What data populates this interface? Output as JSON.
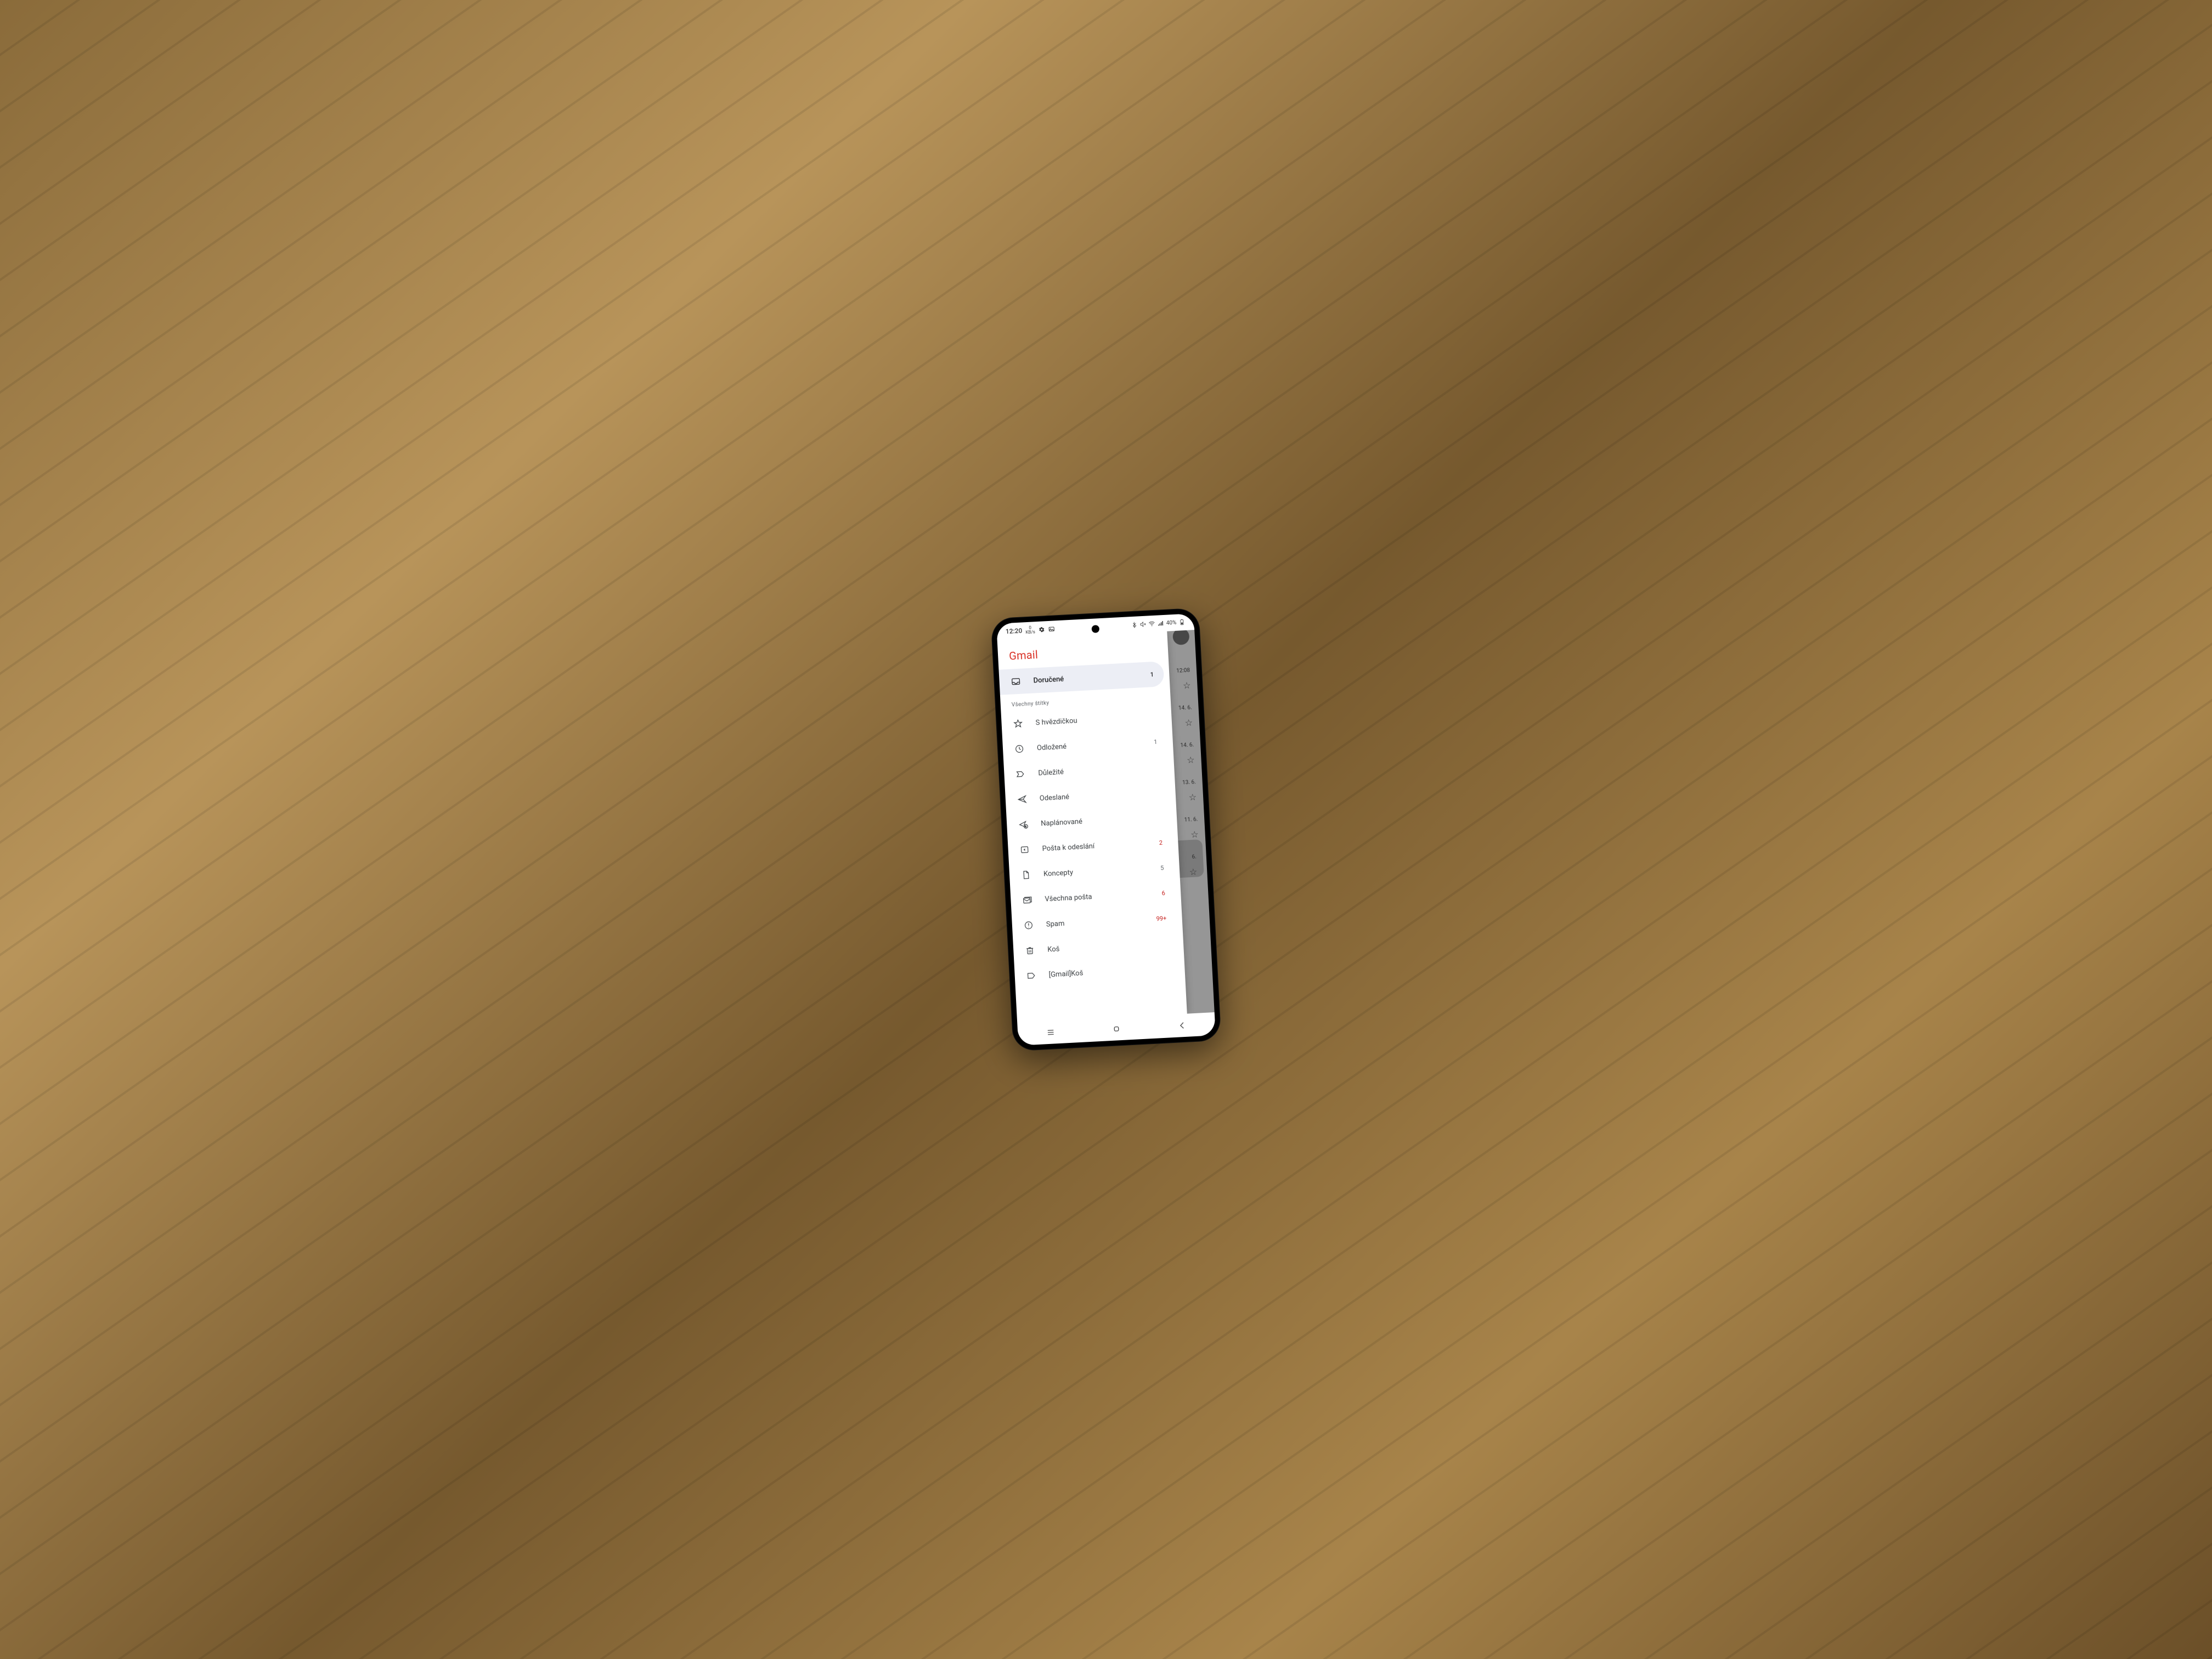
{
  "statusbar": {
    "time": "12:20",
    "net_speed_value": "0",
    "net_speed_unit": "KB/s",
    "battery_text": "40%"
  },
  "app": {
    "title": "Gmail"
  },
  "drawer": {
    "primary": {
      "icon": "inbox",
      "label": "Doručené",
      "badge": "1"
    },
    "section_label": "Všechny štítky",
    "items": [
      {
        "icon": "star",
        "label": "S hvězdičkou",
        "badge": ""
      },
      {
        "icon": "clock",
        "label": "Odložené",
        "badge": "1"
      },
      {
        "icon": "important",
        "label": "Důležité",
        "badge": ""
      },
      {
        "icon": "send",
        "label": "Odeslané",
        "badge": ""
      },
      {
        "icon": "scheduled",
        "label": "Naplánované",
        "badge": ""
      },
      {
        "icon": "outbox",
        "label": "Pošta k odeslání",
        "badge": "2",
        "accent": true
      },
      {
        "icon": "draft",
        "label": "Koncepty",
        "badge": "5"
      },
      {
        "icon": "allmail",
        "label": "Všechna pošta",
        "badge": "6",
        "accent": true
      },
      {
        "icon": "spam",
        "label": "Spam",
        "badge": "99+",
        "accent": true
      },
      {
        "icon": "trash",
        "label": "Koš",
        "badge": ""
      },
      {
        "icon": "label",
        "label": "[Gmail]Koš",
        "badge": ""
      }
    ]
  },
  "bg_inbox": {
    "rows": [
      {
        "time": "12:08"
      },
      {
        "time": "14. 6."
      },
      {
        "time": "14. 6."
      },
      {
        "time": "13. 6."
      },
      {
        "time": "11. 6."
      },
      {
        "time": "6.",
        "highlight": true
      }
    ]
  }
}
